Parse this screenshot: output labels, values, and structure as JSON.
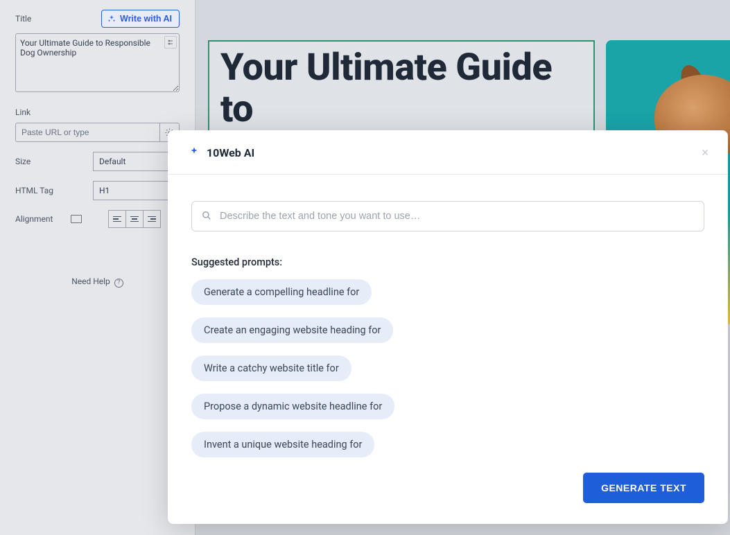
{
  "sidebar": {
    "title_label": "Title",
    "write_ai_label": "Write with AI",
    "title_value": "Your Ultimate Guide to Responsible Dog Ownership",
    "link_label": "Link",
    "link_placeholder": "Paste URL or type",
    "size_label": "Size",
    "size_value": "Default",
    "html_tag_label": "HTML Tag",
    "html_tag_value": "H1",
    "alignment_label": "Alignment",
    "need_help": "Need Help"
  },
  "canvas": {
    "heading": "Your Ultimate Guide to"
  },
  "modal": {
    "title": "10Web AI",
    "input_placeholder": "Describe the text and tone you want to use…",
    "suggested_label": "Suggested prompts:",
    "prompts": [
      "Generate a compelling headline for",
      "Create an engaging website heading for",
      "Write a catchy website title for",
      "Propose a dynamic website headline for",
      "Invent a unique website heading for"
    ],
    "generate_label": "GENERATE TEXT"
  }
}
